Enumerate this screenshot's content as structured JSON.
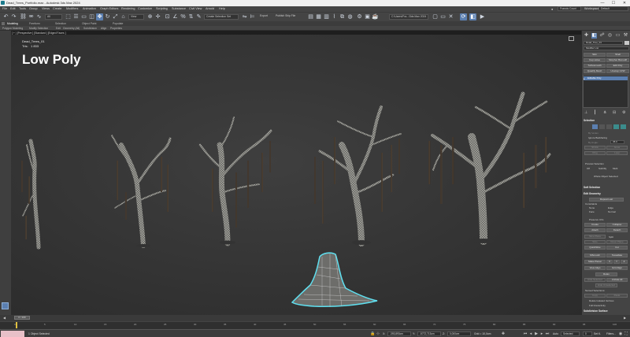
{
  "titlebar": {
    "title": "Dead_Trees_Portfolio.max - Autodesk 3ds Max 2024",
    "minimize": "—",
    "maximize": "☐",
    "close": "✕"
  },
  "menus": [
    "File",
    "Edit",
    "Tools",
    "Group",
    "Views",
    "Create",
    "Modifiers",
    "Animation",
    "Graph Editors",
    "Rendering",
    "Customize",
    "Scripting",
    "Substance",
    "Civil View",
    "Arnold",
    "Help"
  ],
  "user": {
    "name": "Francis Couni"
  },
  "workspace": {
    "label": "Workspaces:",
    "value": "Default"
  },
  "toolbar": {
    "filter_value": "All",
    "view_value": "View",
    "selection_set_placeholder": "Create Selection Set",
    "export_label": "Export",
    "publish_label": "Publish Ship File",
    "project_path": "C:\\Users\\Fra...\\3ds Max 2024"
  },
  "ribbon": {
    "tabs": [
      "Modeling",
      "Freeform",
      "Selection",
      "Object Paint",
      "Populate"
    ],
    "selected_tab": 0,
    "subtabs": [
      "Polygon Modeling",
      "Modify Selection",
      "Edit",
      "Geometry (All)",
      "Subdivision",
      "Align",
      "Properties"
    ]
  },
  "viewport": {
    "label": "[ + ] [Perspective ] [Standard ] [Edged Faces ]",
    "object_name": "Dead_Trees_01",
    "tris_label": "Tris:",
    "tris_value": "1 833",
    "title": "Low Poly"
  },
  "command_panel": {
    "object_name": "Dead_Tree_01",
    "modifier_list": "Modifier List",
    "buttons": [
      [
        "Skin",
        "Shell"
      ],
      [
        "Cap Holes",
        "Morpher Bsmodif"
      ],
      [
        "Turbosmooth",
        "Edit Poly"
      ],
      [
        "Quadify Mesh",
        "Unwrap UVW"
      ]
    ],
    "stack_item": "Editable Poly",
    "selection_rollout": "Selection",
    "by_vertex": "By Vertex",
    "ignore_backfacing": "Ignore Backfacing",
    "by_angle": "By Angle:",
    "angle_value": "45.0",
    "shrink": "Shrink",
    "grow": "Grow",
    "ring": "Ring",
    "loop": "Loop",
    "preview_selection": "Preview Selection",
    "preview_off": "Off",
    "preview_subobj": "SubObj",
    "preview_multi": "Multi",
    "whole_object": "Whole Object Selected",
    "soft_selection": "Soft Selection",
    "edit_geometry": "Edit Geometry",
    "repeat_last": "Repeat Last",
    "constraints": "Constraints",
    "c_none": "None",
    "c_edge": "Edge",
    "c_face": "Face",
    "c_normal": "Normal",
    "preserve_uvs": "Preserve UVs",
    "create": "Create",
    "collapse": "Collapse",
    "attach": "Attach",
    "detach": "Detach",
    "slice_plane": "Slice Plane",
    "split": "Split",
    "slice": "Slice",
    "reset_plane": "Reset Plane",
    "quickslice": "QuickSlice",
    "cut": "Cut",
    "msmooth": "MSmooth",
    "tessellate": "Tessellate",
    "make_planar": "Make Planar",
    "x": "X",
    "y": "Y",
    "z": "Z",
    "view_align": "View Align",
    "grid_align": "Grid Align",
    "relax": "Relax",
    "hide_selected": "Hide Selected",
    "unhide_all": "Unhide All",
    "hide_unselected": "Hide Unselected",
    "named_selections": "Named Selections:",
    "copy": "Copy",
    "paste": "Paste",
    "delete_isolated": "Delete Isolated Vertices",
    "full_interactivity": "Full Interactivity",
    "subdivision_surface": "Subdivision Surface"
  },
  "timeline": {
    "slider": "0 / 100",
    "ticks": [
      "0",
      "5",
      "10",
      "15",
      "20",
      "25",
      "30",
      "35",
      "40",
      "45",
      "50",
      "55",
      "60",
      "65",
      "70",
      "75",
      "80",
      "85",
      "90",
      "95",
      "100"
    ]
  },
  "status": {
    "selection": "1 Object Selected",
    "x_label": "X:",
    "x_value": "-393,893cm",
    "y_label": "Y:",
    "y_value": "-5772,713cm",
    "z_label": "Z:",
    "z_value": "0,000cm",
    "grid": "Grid = 10,0cm",
    "auto_key": "Auto",
    "selected_dropdown": "Selected",
    "set_key": "Set K.",
    "filters": "Filters...",
    "frame": "0"
  },
  "colors": {
    "accent": "#5b7fb0",
    "selection_outline": "#5fe0f0",
    "maxscript": "#e8c0c8"
  }
}
